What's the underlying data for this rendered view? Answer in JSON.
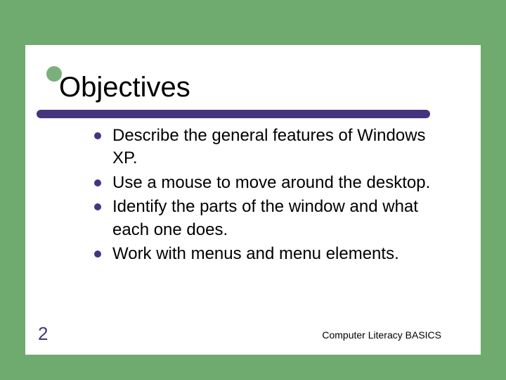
{
  "title": "Objectives",
  "bullets": [
    "Describe the general features of Windows XP.",
    "Use a mouse to move around the desktop.",
    "Identify the parts of the window and what each one does.",
    "Work with menus and menu elements."
  ],
  "pageNumber": "2",
  "footer": "Computer Literacy BASICS"
}
